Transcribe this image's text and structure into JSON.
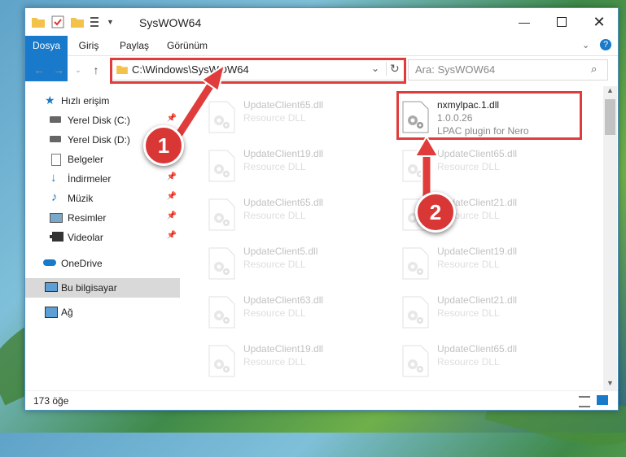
{
  "window": {
    "title": "SysWOW64"
  },
  "ribbon": {
    "tabs": [
      {
        "label": "Dosya"
      },
      {
        "label": "Giriş"
      },
      {
        "label": "Paylaş"
      },
      {
        "label": "Görünüm"
      }
    ]
  },
  "address": {
    "path": "C:\\Windows\\SysWOW64"
  },
  "search": {
    "placeholder": "Ara: SysWOW64"
  },
  "nav": {
    "items": [
      {
        "label": "Hızlı erişim",
        "icon": "star-icon"
      },
      {
        "label": "Yerel Disk (C:)",
        "icon": "drive-icon"
      },
      {
        "label": "Yerel Disk (D:)",
        "icon": "drive-icon"
      },
      {
        "label": "Belgeler",
        "icon": "documents-icon"
      },
      {
        "label": "İndirmeler",
        "icon": "download-icon"
      },
      {
        "label": "Müzik",
        "icon": "music-icon"
      },
      {
        "label": "Resimler",
        "icon": "pictures-icon"
      },
      {
        "label": "Videolar",
        "icon": "video-icon"
      },
      {
        "label": "OneDrive",
        "icon": "cloud-icon"
      },
      {
        "label": "Bu bilgisayar",
        "icon": "computer-icon"
      },
      {
        "label": "Ağ",
        "icon": "network-icon"
      }
    ]
  },
  "files": [
    {
      "name": "UpdateClient65.dll",
      "type": "Resource DLL",
      "desc": ""
    },
    {
      "name": "nxmylpac.1.dll",
      "type": "1.0.0.26",
      "desc": "LPAC plugin for Nero"
    },
    {
      "name": "UpdateClient19.dll",
      "type": "Resource DLL",
      "desc": ""
    },
    {
      "name": "UpdateClient65.dll",
      "type": "Resource DLL",
      "desc": ""
    },
    {
      "name": "UpdateClient65.dll",
      "type": "Resource DLL",
      "desc": ""
    },
    {
      "name": "UpdateClient21.dll",
      "type": "Resource DLL",
      "desc": ""
    },
    {
      "name": "UpdateClient5.dll",
      "type": "Resource DLL",
      "desc": ""
    },
    {
      "name": "UpdateClient19.dll",
      "type": "Resource DLL",
      "desc": ""
    },
    {
      "name": "UpdateClient63.dll",
      "type": "Resource DLL",
      "desc": ""
    },
    {
      "name": "UpdateClient21.dll",
      "type": "Resource DLL",
      "desc": ""
    },
    {
      "name": "UpdateClient19.dll",
      "type": "Resource DLL",
      "desc": ""
    },
    {
      "name": "UpdateClient65.dll",
      "type": "Resource DLL",
      "desc": ""
    }
  ],
  "status": {
    "count": "173 öğe"
  },
  "annotations": {
    "step1": "1",
    "step2": "2",
    "color": "#e03c3c"
  }
}
